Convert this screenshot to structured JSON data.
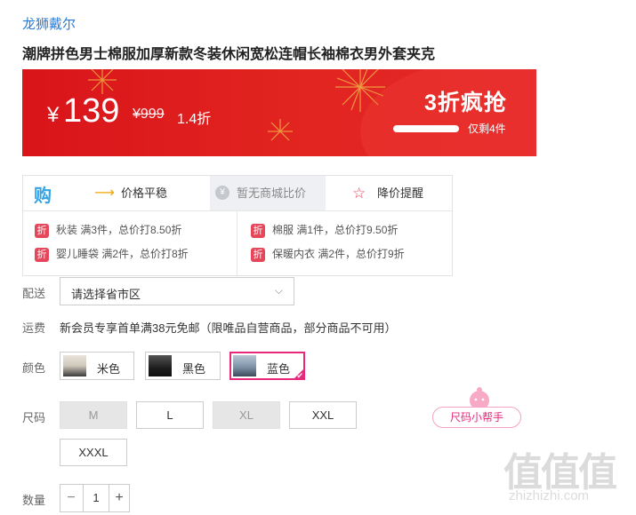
{
  "brand": "龙狮戴尔",
  "product_title": "潮牌拼色男士棉服加厚新款冬装休闲宽松连帽长袖棉衣男外套夹克",
  "banner": {
    "currency": "¥",
    "price": "139",
    "original_price": "¥999",
    "discount": "1.4折",
    "flash_title": "3折疯抢",
    "remaining": "仅剩4件",
    "stock_remaining_fraction": 0.97,
    "colors": {
      "bg": "#d9141a",
      "accent": "#f2c24a"
    }
  },
  "price_tools": {
    "logo": "购",
    "items": [
      {
        "label": "价格平稳",
        "icon": "arrow-right-icon"
      },
      {
        "label": "暂无商城比价",
        "icon": "yen-circle-icon"
      },
      {
        "label": "降价提醒",
        "icon": "star-icon"
      }
    ]
  },
  "promotions": {
    "badge": "折",
    "left": [
      "秋装 满3件，总价打8.50折",
      "婴儿睡袋 满2件，总价打8折"
    ],
    "right": [
      "棉服 满1件，总价打9.50折",
      "保暖内衣 满2件，总价打9折"
    ]
  },
  "delivery": {
    "label": "配送",
    "placeholder": "请选择省市区"
  },
  "shipping": {
    "label": "运费",
    "text": "新会员专享首单满38元免邮（限唯品自营商品，部分商品不可用）"
  },
  "color": {
    "label": "颜色",
    "options": [
      "米色",
      "黑色",
      "蓝色"
    ],
    "selected": "蓝色"
  },
  "size": {
    "label": "尺码",
    "options": [
      "M",
      "L",
      "XL",
      "XXL",
      "XXXL"
    ],
    "disabled": [
      "M",
      "XL"
    ],
    "helper": "尺码小帮手"
  },
  "quantity": {
    "label": "数量",
    "value": "1",
    "minus": "−",
    "plus": "+"
  },
  "watermark": {
    "big": "值值值",
    "small": "zhizhizhi.com"
  },
  "accent_color": "#e8287a"
}
